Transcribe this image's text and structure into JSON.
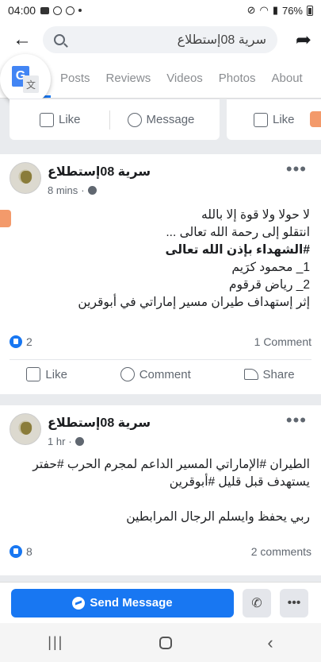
{
  "status_bar": {
    "time": "04:00",
    "battery": "76%"
  },
  "header": {
    "search_text": "سرية 08إستطلاع"
  },
  "tabs": [
    {
      "label": "Posts"
    },
    {
      "label": "Reviews"
    },
    {
      "label": "Videos"
    },
    {
      "label": "Photos"
    },
    {
      "label": "About"
    }
  ],
  "top_actions": {
    "like": "Like",
    "message": "Message",
    "like2": "Like"
  },
  "posts": [
    {
      "page_name": "سرية 08إستطلاع",
      "time": "8 mins",
      "lines": [
        "لا حولا ولا قوة إلا بالله",
        "انتقلو إلى رحمة الله تعالى ...",
        "#الشهداء بإذن الله تعالى",
        "1_ محمود كرَيم",
        "2_ رياض قرقوم",
        "إثر إستهداف طيران مسير إماراتي في أبوقرين"
      ],
      "reactions": "2",
      "comments": "1 Comment",
      "actions": {
        "like": "Like",
        "comment": "Comment",
        "share": "Share"
      }
    },
    {
      "page_name": "سرية 08إستطلاع",
      "time": "1 hr",
      "lines": [
        "الطيران #الإماراتي المسير الداعم لمجرم الحرب #حفتر",
        "يستهدف قبل قليل #أبوقرين",
        "",
        "ربي يحفظ وايسلم الرجال المرابطين"
      ],
      "reactions": "8",
      "comments": "2 comments"
    }
  ],
  "bottom_bar": {
    "send_message": "Send Message"
  },
  "colors": {
    "brand": "#1877f2",
    "background": "#e9ebee"
  }
}
